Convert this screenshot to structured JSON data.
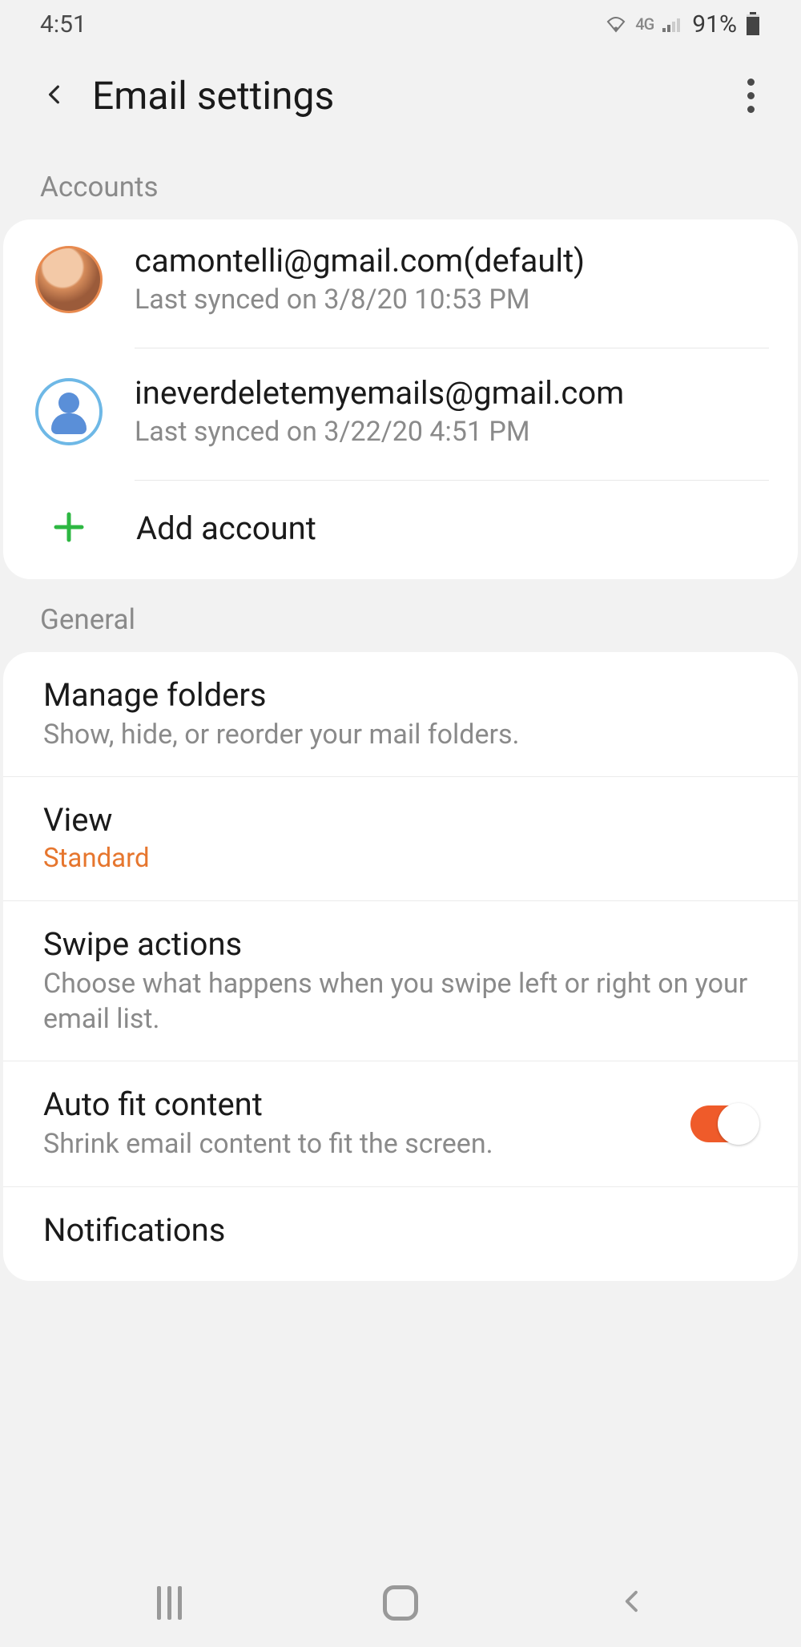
{
  "status_bar": {
    "time": "4:51",
    "network": "4G",
    "battery_pct": "91%"
  },
  "header": {
    "title": "Email settings"
  },
  "sections": {
    "accounts_label": "Accounts",
    "general_label": "General"
  },
  "accounts": [
    {
      "email": "camontelli@gmail.com(default)",
      "sync": "Last synced on 3/8/20  10:53 PM",
      "avatar_type": "photo"
    },
    {
      "email": "ineverdeletemyemails@gmail.com",
      "sync": "Last synced on 3/22/20  4:51 PM",
      "avatar_type": "generic"
    }
  ],
  "add_account_label": "Add account",
  "general": {
    "manage_folders": {
      "title": "Manage folders",
      "sub": "Show, hide, or reorder your mail folders."
    },
    "view": {
      "title": "View",
      "value": "Standard"
    },
    "swipe": {
      "title": "Swipe actions",
      "sub": "Choose what happens when you swipe left or right on your email list."
    },
    "autofit": {
      "title": "Auto fit content",
      "sub": "Shrink email content to fit the screen.",
      "enabled": true
    },
    "notifications": {
      "title": "Notifications"
    }
  },
  "colors": {
    "accent": "#e6762e",
    "toggle_on": "#ef5b2a",
    "add_plus": "#2db742"
  }
}
